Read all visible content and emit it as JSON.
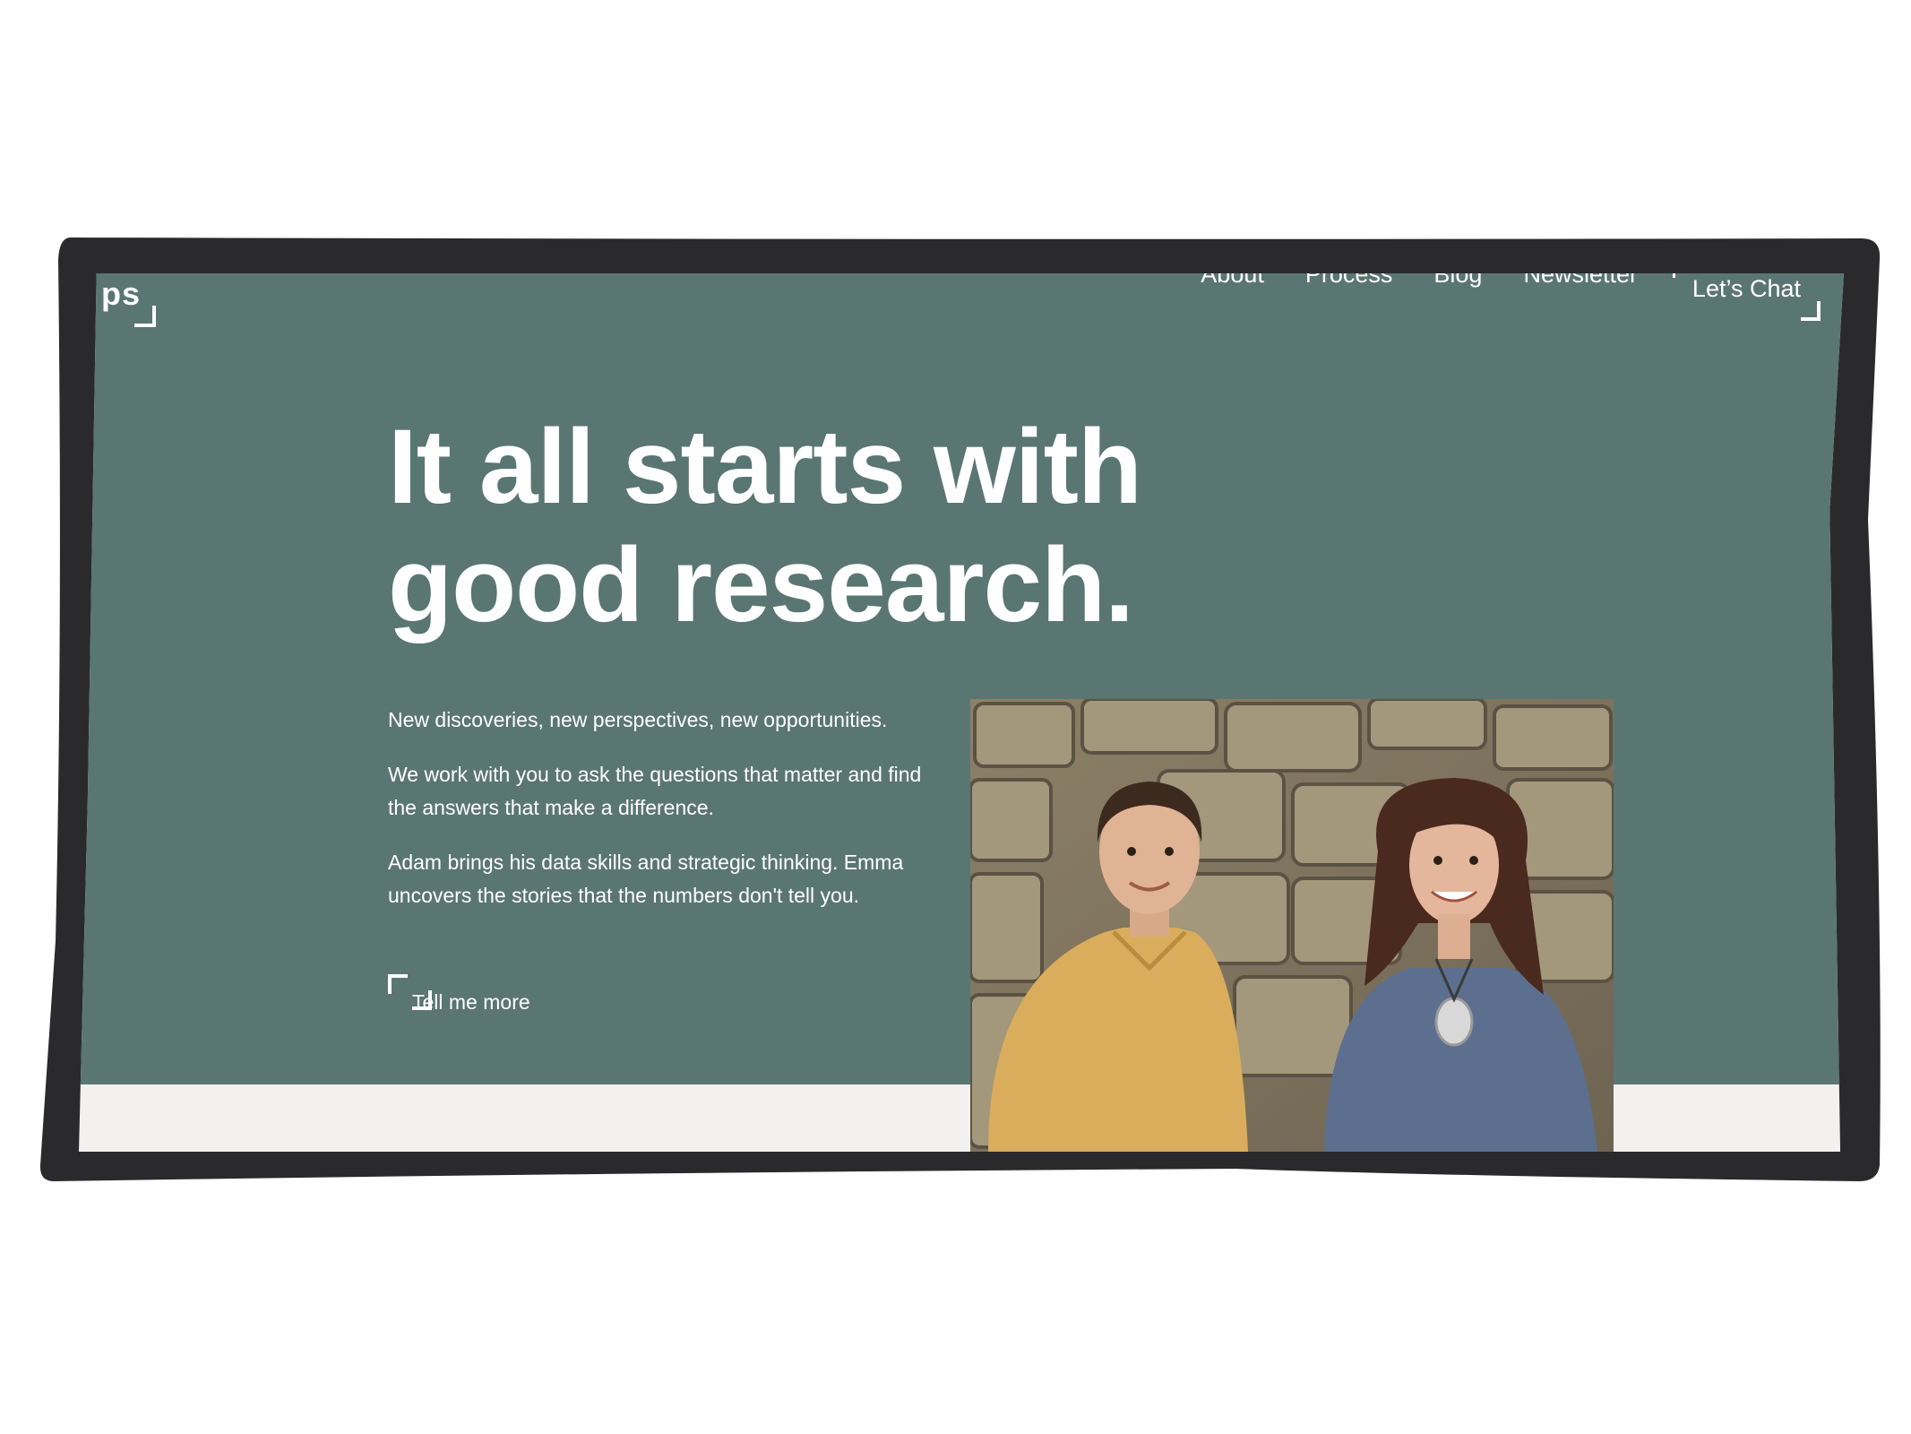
{
  "header": {
    "logo": "ps",
    "nav": [
      "About",
      "Process",
      "Blog",
      "Newsletter"
    ],
    "cta": "Let’s Chat"
  },
  "hero": {
    "headline_line1": "It all starts with",
    "headline_line2": "good research.",
    "paragraphs": [
      "New discoveries, new perspectives, new opportunities.",
      "We work with you to ask the questions that matter and find the answers that make a difference.",
      "Adam brings his data skills and strategic thinking. Emma uncovers the stories that the numbers don't tell you."
    ],
    "cta": "Tell me more"
  },
  "colors": {
    "hero_bg": "#5a7672",
    "frame": "#2a2a2c",
    "lower_bg": "#f2f1ef",
    "text": "#ffffff"
  }
}
